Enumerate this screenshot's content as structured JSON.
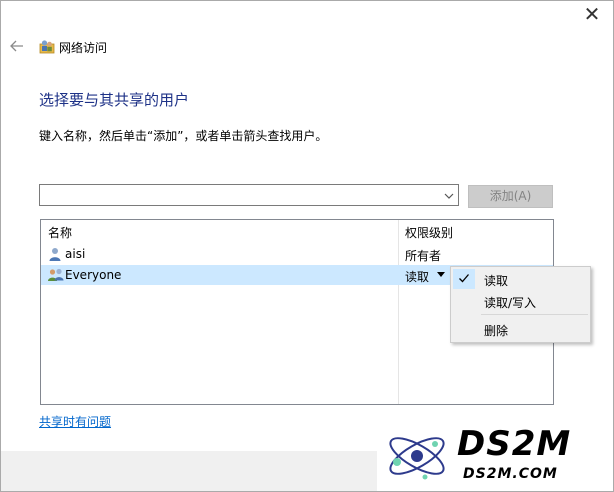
{
  "window": {
    "title": "网络访问",
    "close_symbol": "✕"
  },
  "page": {
    "heading": "选择要与其共享的用户",
    "instruction": "键入名称，然后单击“添加”，或者单击箭头查找用户。"
  },
  "name_input": {
    "value": "",
    "placeholder": ""
  },
  "add_button": {
    "label": "添加(A)"
  },
  "user_list": {
    "columns": [
      "名称",
      "权限级别"
    ],
    "rows": [
      {
        "name": "aisi",
        "permission": "所有者",
        "icon": "user-icon"
      },
      {
        "name": "Everyone",
        "permission": "读取",
        "icon": "group-icon",
        "selected": true
      }
    ]
  },
  "permission_menu": {
    "items": [
      {
        "label": "读取",
        "checked": true
      },
      {
        "label": "读取/写入",
        "checked": false
      },
      {
        "label": "删除",
        "checked": false
      }
    ]
  },
  "help_link": {
    "label": "共享时有问题"
  },
  "watermark": {
    "title": "DS2M",
    "subtitle": "DS2M.COM"
  },
  "colors": {
    "heading": "#1e3287",
    "link": "#0066cc",
    "selection": "#cce8ff",
    "disabled_button": "#cccccc"
  }
}
